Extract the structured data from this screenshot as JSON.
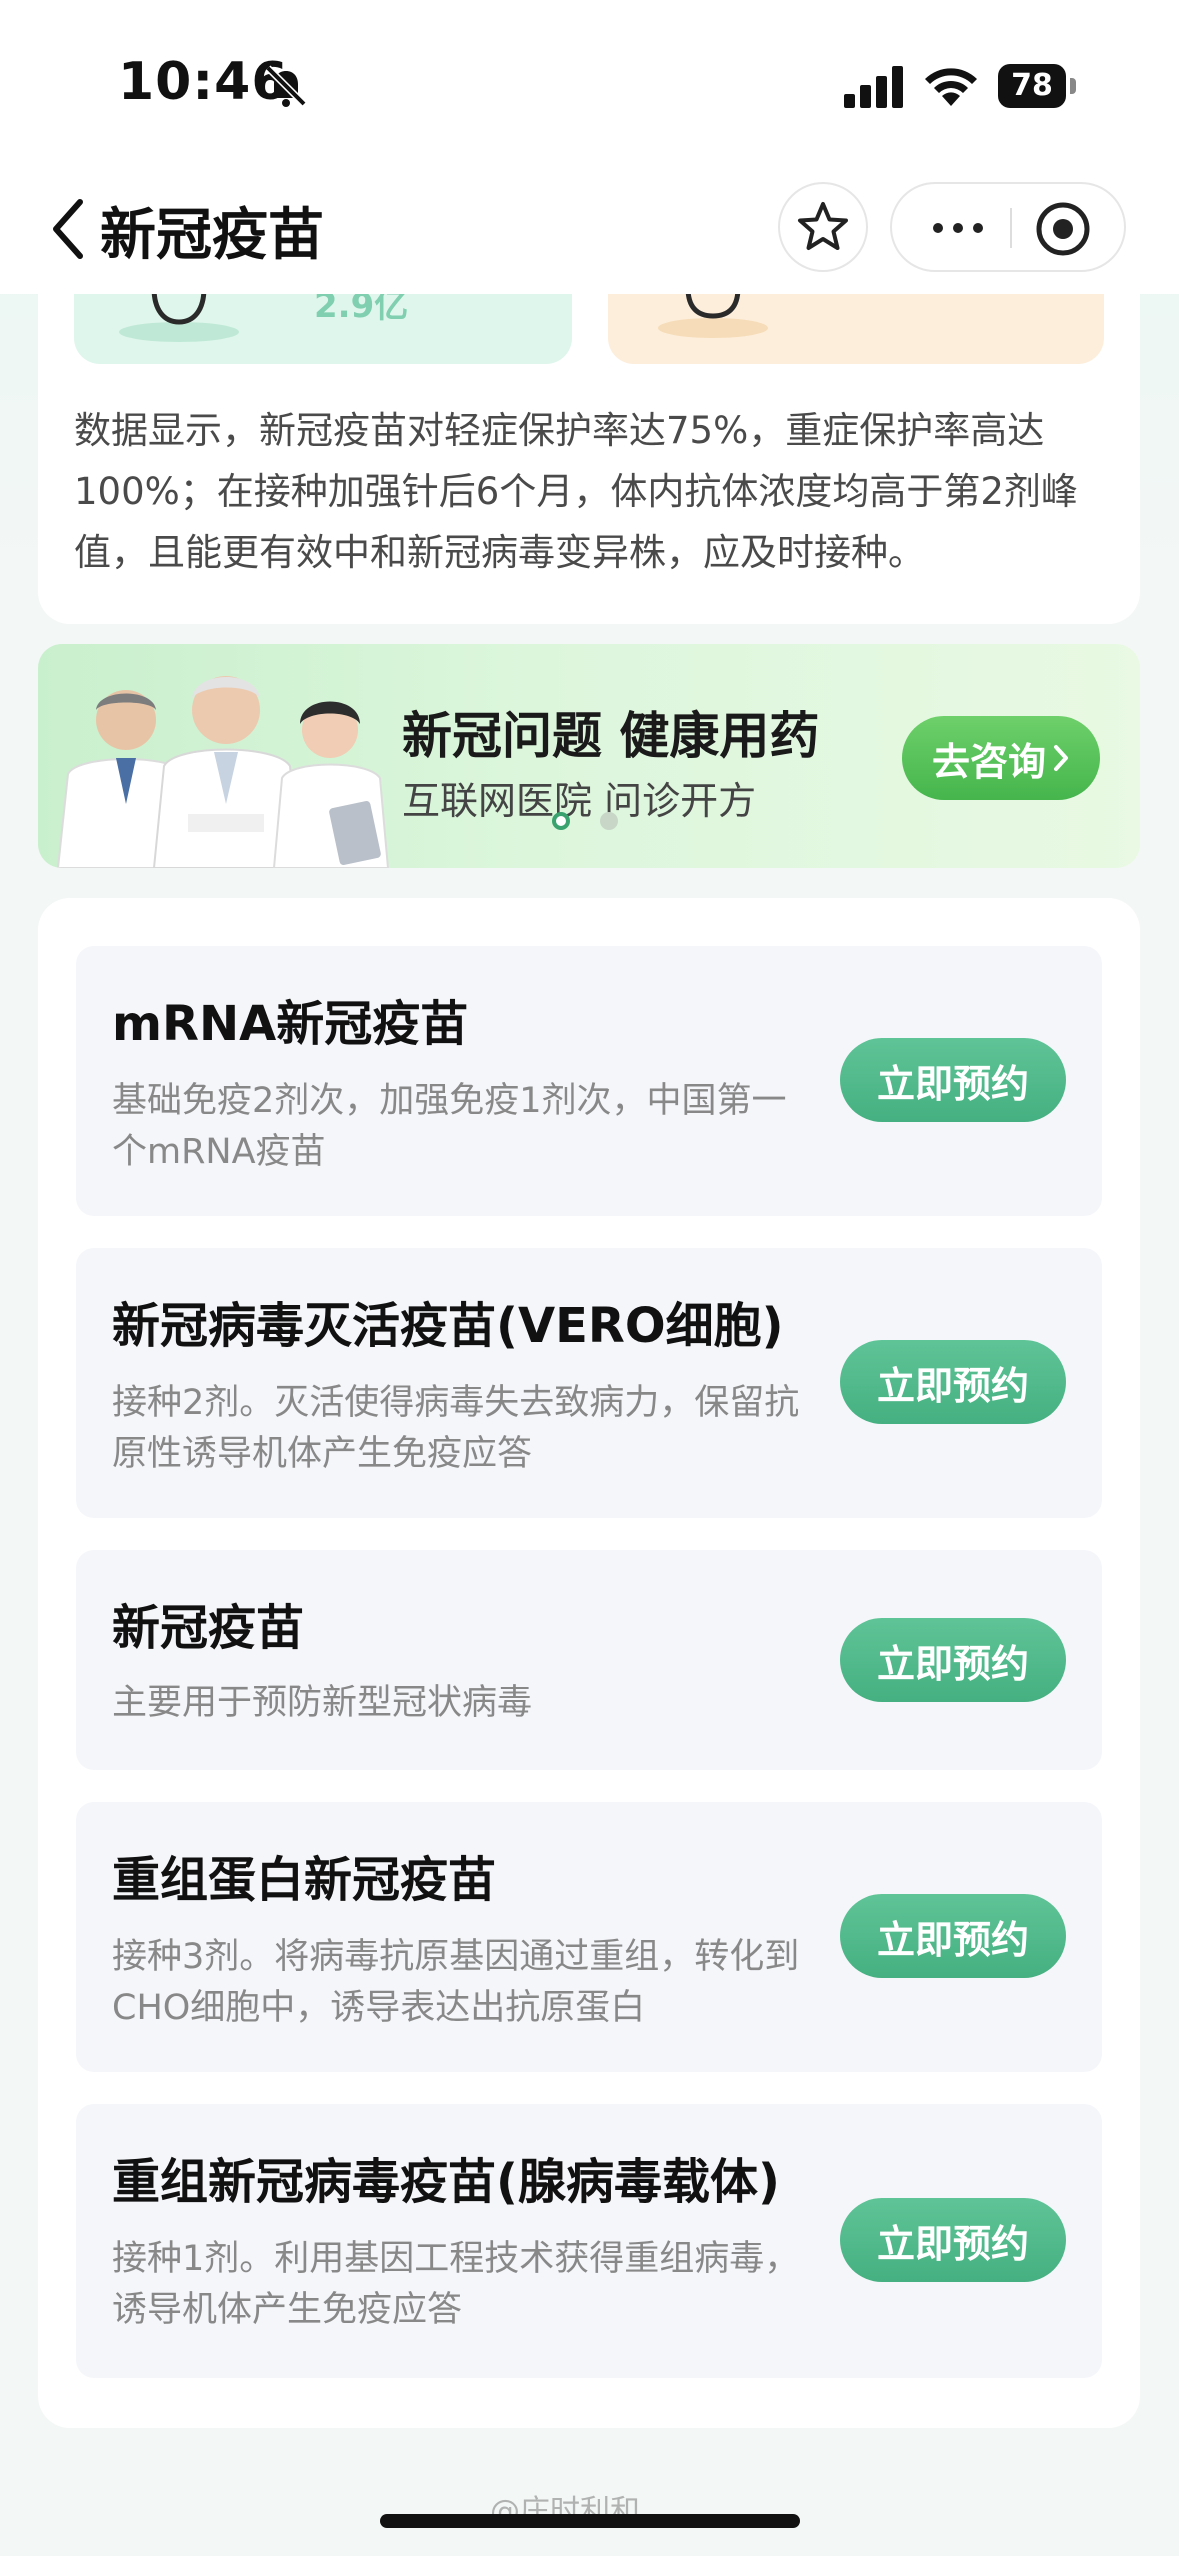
{
  "status_bar": {
    "time": "10:46",
    "battery": "78",
    "icons": [
      "bell-slash-icon",
      "signal-icon",
      "wifi-icon",
      "battery-icon"
    ]
  },
  "nav": {
    "title": "新冠疫苗",
    "icons": [
      "back-icon",
      "star-icon",
      "more-icon",
      "target-icon"
    ]
  },
  "info_card": {
    "stat_value": "2.9亿",
    "paragraph": "数据显示，新冠疫苗对轻症保护率达75%，重症保护率高达100%；在接种加强针后6个月，体内抗体浓度均高于第2剂峰值，且能更有效中和新冠病毒变异株，应及时接种。"
  },
  "banner": {
    "title": "新冠问题 健康用药",
    "subtitle": "互联网医院 问诊开方",
    "button_label": "去咨询",
    "page_count": 2,
    "active_page": 1
  },
  "vaccines": [
    {
      "name": "mRNA新冠疫苗",
      "desc": "基础免疫2剂次，加强免疫1剂次，中国第一个mRNA疫苗",
      "button": "立即预约"
    },
    {
      "name": "新冠病毒灭活疫苗(VERO细胞)",
      "desc": "接种2剂。灭活使得病毒失去致病力，保留抗原性诱导机体产生免疫应答",
      "button": "立即预约"
    },
    {
      "name": "新冠疫苗",
      "desc": "主要用于预防新型冠状病毒",
      "button": "立即预约"
    },
    {
      "name": "重组蛋白新冠疫苗",
      "desc": "接种3剂。将病毒抗原基因通过重组，转化到CHO细胞中，诱导表达出抗原蛋白",
      "button": "立即预约"
    },
    {
      "name": "重组新冠病毒疫苗(腺病毒载体)",
      "desc": "接种1剂。利用基因工程技术获得重组病毒，诱导机体产生免疫应答",
      "button": "立即预约"
    }
  ],
  "watermark": "@庄时利和",
  "colors": {
    "accent_green": "#4fb789",
    "banner_button": "#4cba52",
    "page_bg": "#f3f7f6"
  }
}
